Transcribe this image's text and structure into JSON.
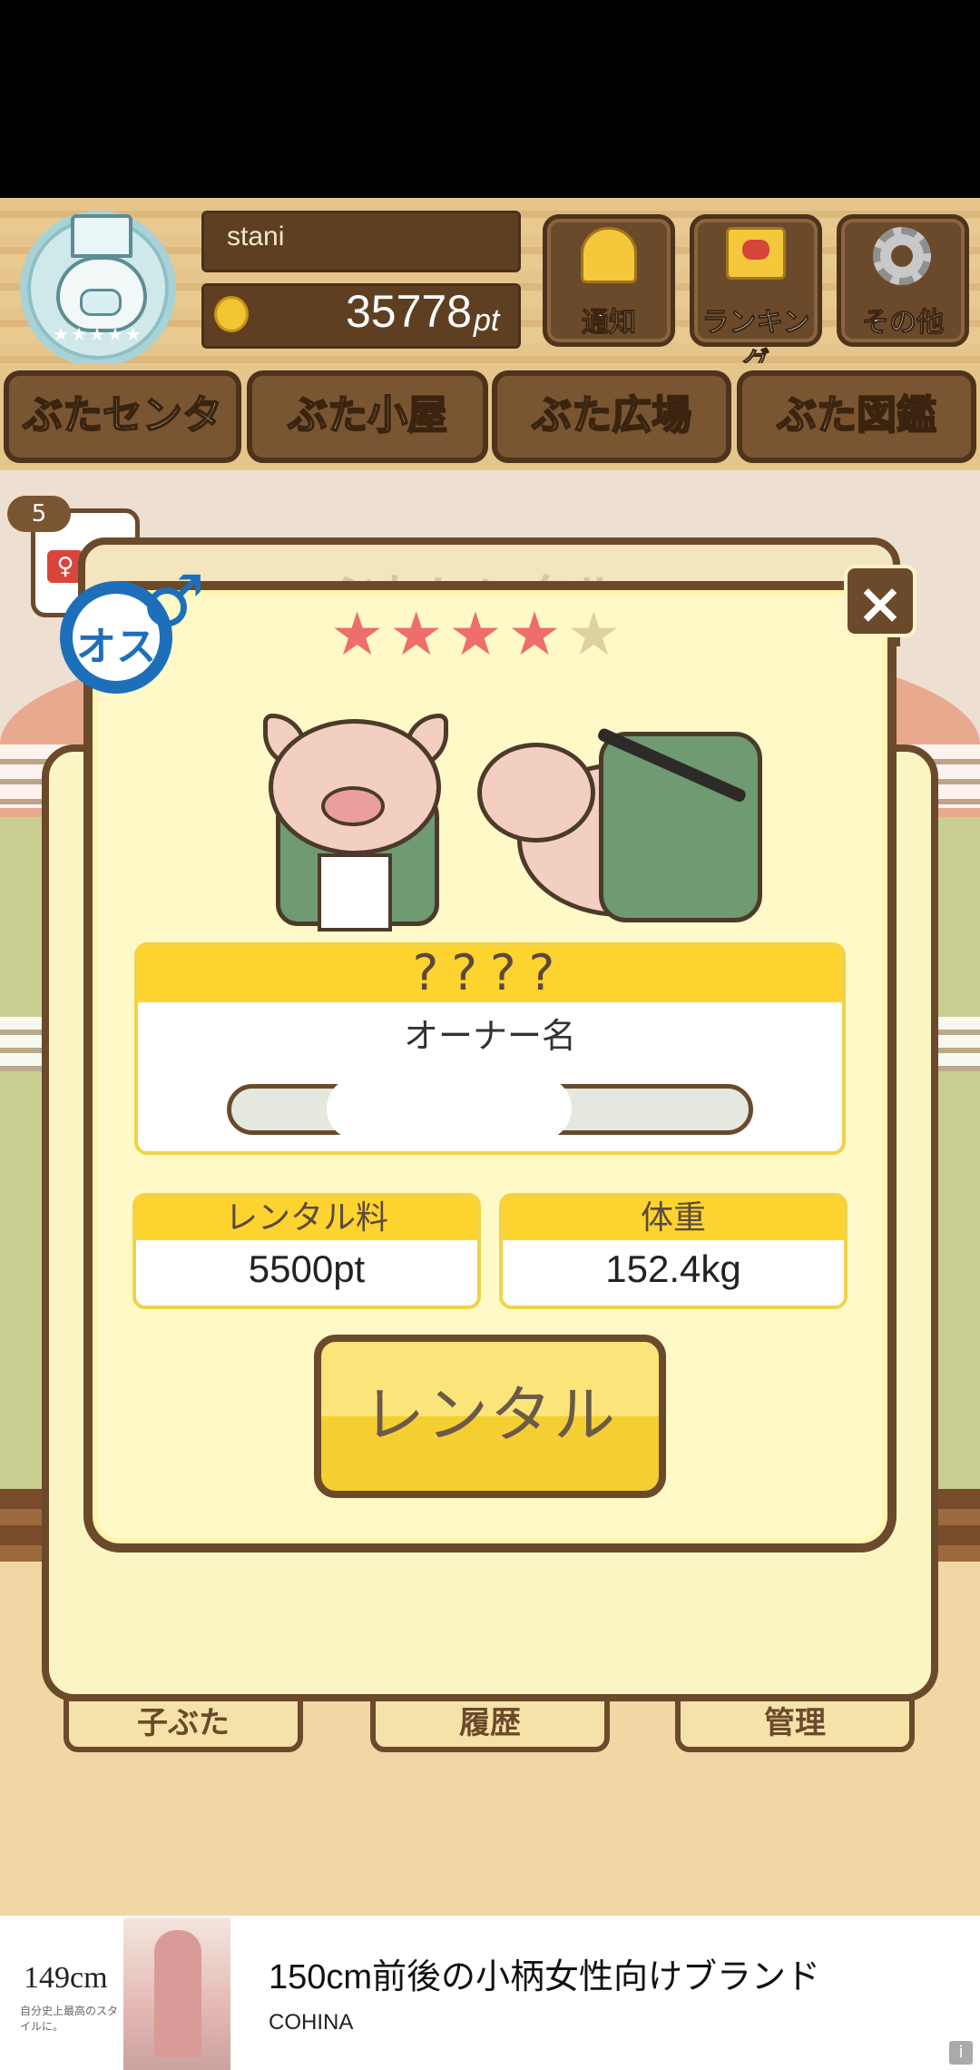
{
  "header": {
    "username": "stani",
    "points": "35778",
    "points_unit": "pt",
    "buttons": {
      "notify": "通知",
      "ranking": "ランキング",
      "other": "その他"
    }
  },
  "tabs": [
    {
      "label": "ぶたセンター",
      "active": false
    },
    {
      "label": "ぶた小屋",
      "active": false
    },
    {
      "label": "ぶた広場",
      "active": true
    },
    {
      "label": "ぶた図鑑",
      "active": false
    }
  ],
  "scene": {
    "counter": "5",
    "female_symbol": "♀",
    "bottom_buttons": {
      "child": "子ぶた",
      "history": "履歴",
      "manage": "管理"
    }
  },
  "dialog": {
    "back_title": "ぶたレンタル",
    "close_symbol": "×",
    "gender": {
      "text": "オス",
      "symbol": "♂",
      "color": "#1d6fba"
    },
    "rating": {
      "value": 4,
      "max": 5
    },
    "pig_name": "????",
    "owner_label": "オーナー名",
    "owner_value": "",
    "fee": {
      "label": "レンタル料",
      "value": "5500pt"
    },
    "weight": {
      "label": "体重",
      "value": "152.4kg"
    },
    "rental_button": "レンタル"
  },
  "ad": {
    "size_text": "149cm",
    "size_caption": "自分史上最高のスタイルに。",
    "title": "150cm前後の小柄女性向けブランド",
    "brand": "COHINA",
    "info_icon": "i"
  },
  "colors": {
    "wood": "#6b4a2b",
    "panel": "#fff9c7",
    "accent_yellow": "#fdd32f",
    "star_on": "#ee6d6d",
    "star_off": "#ddd29d"
  }
}
